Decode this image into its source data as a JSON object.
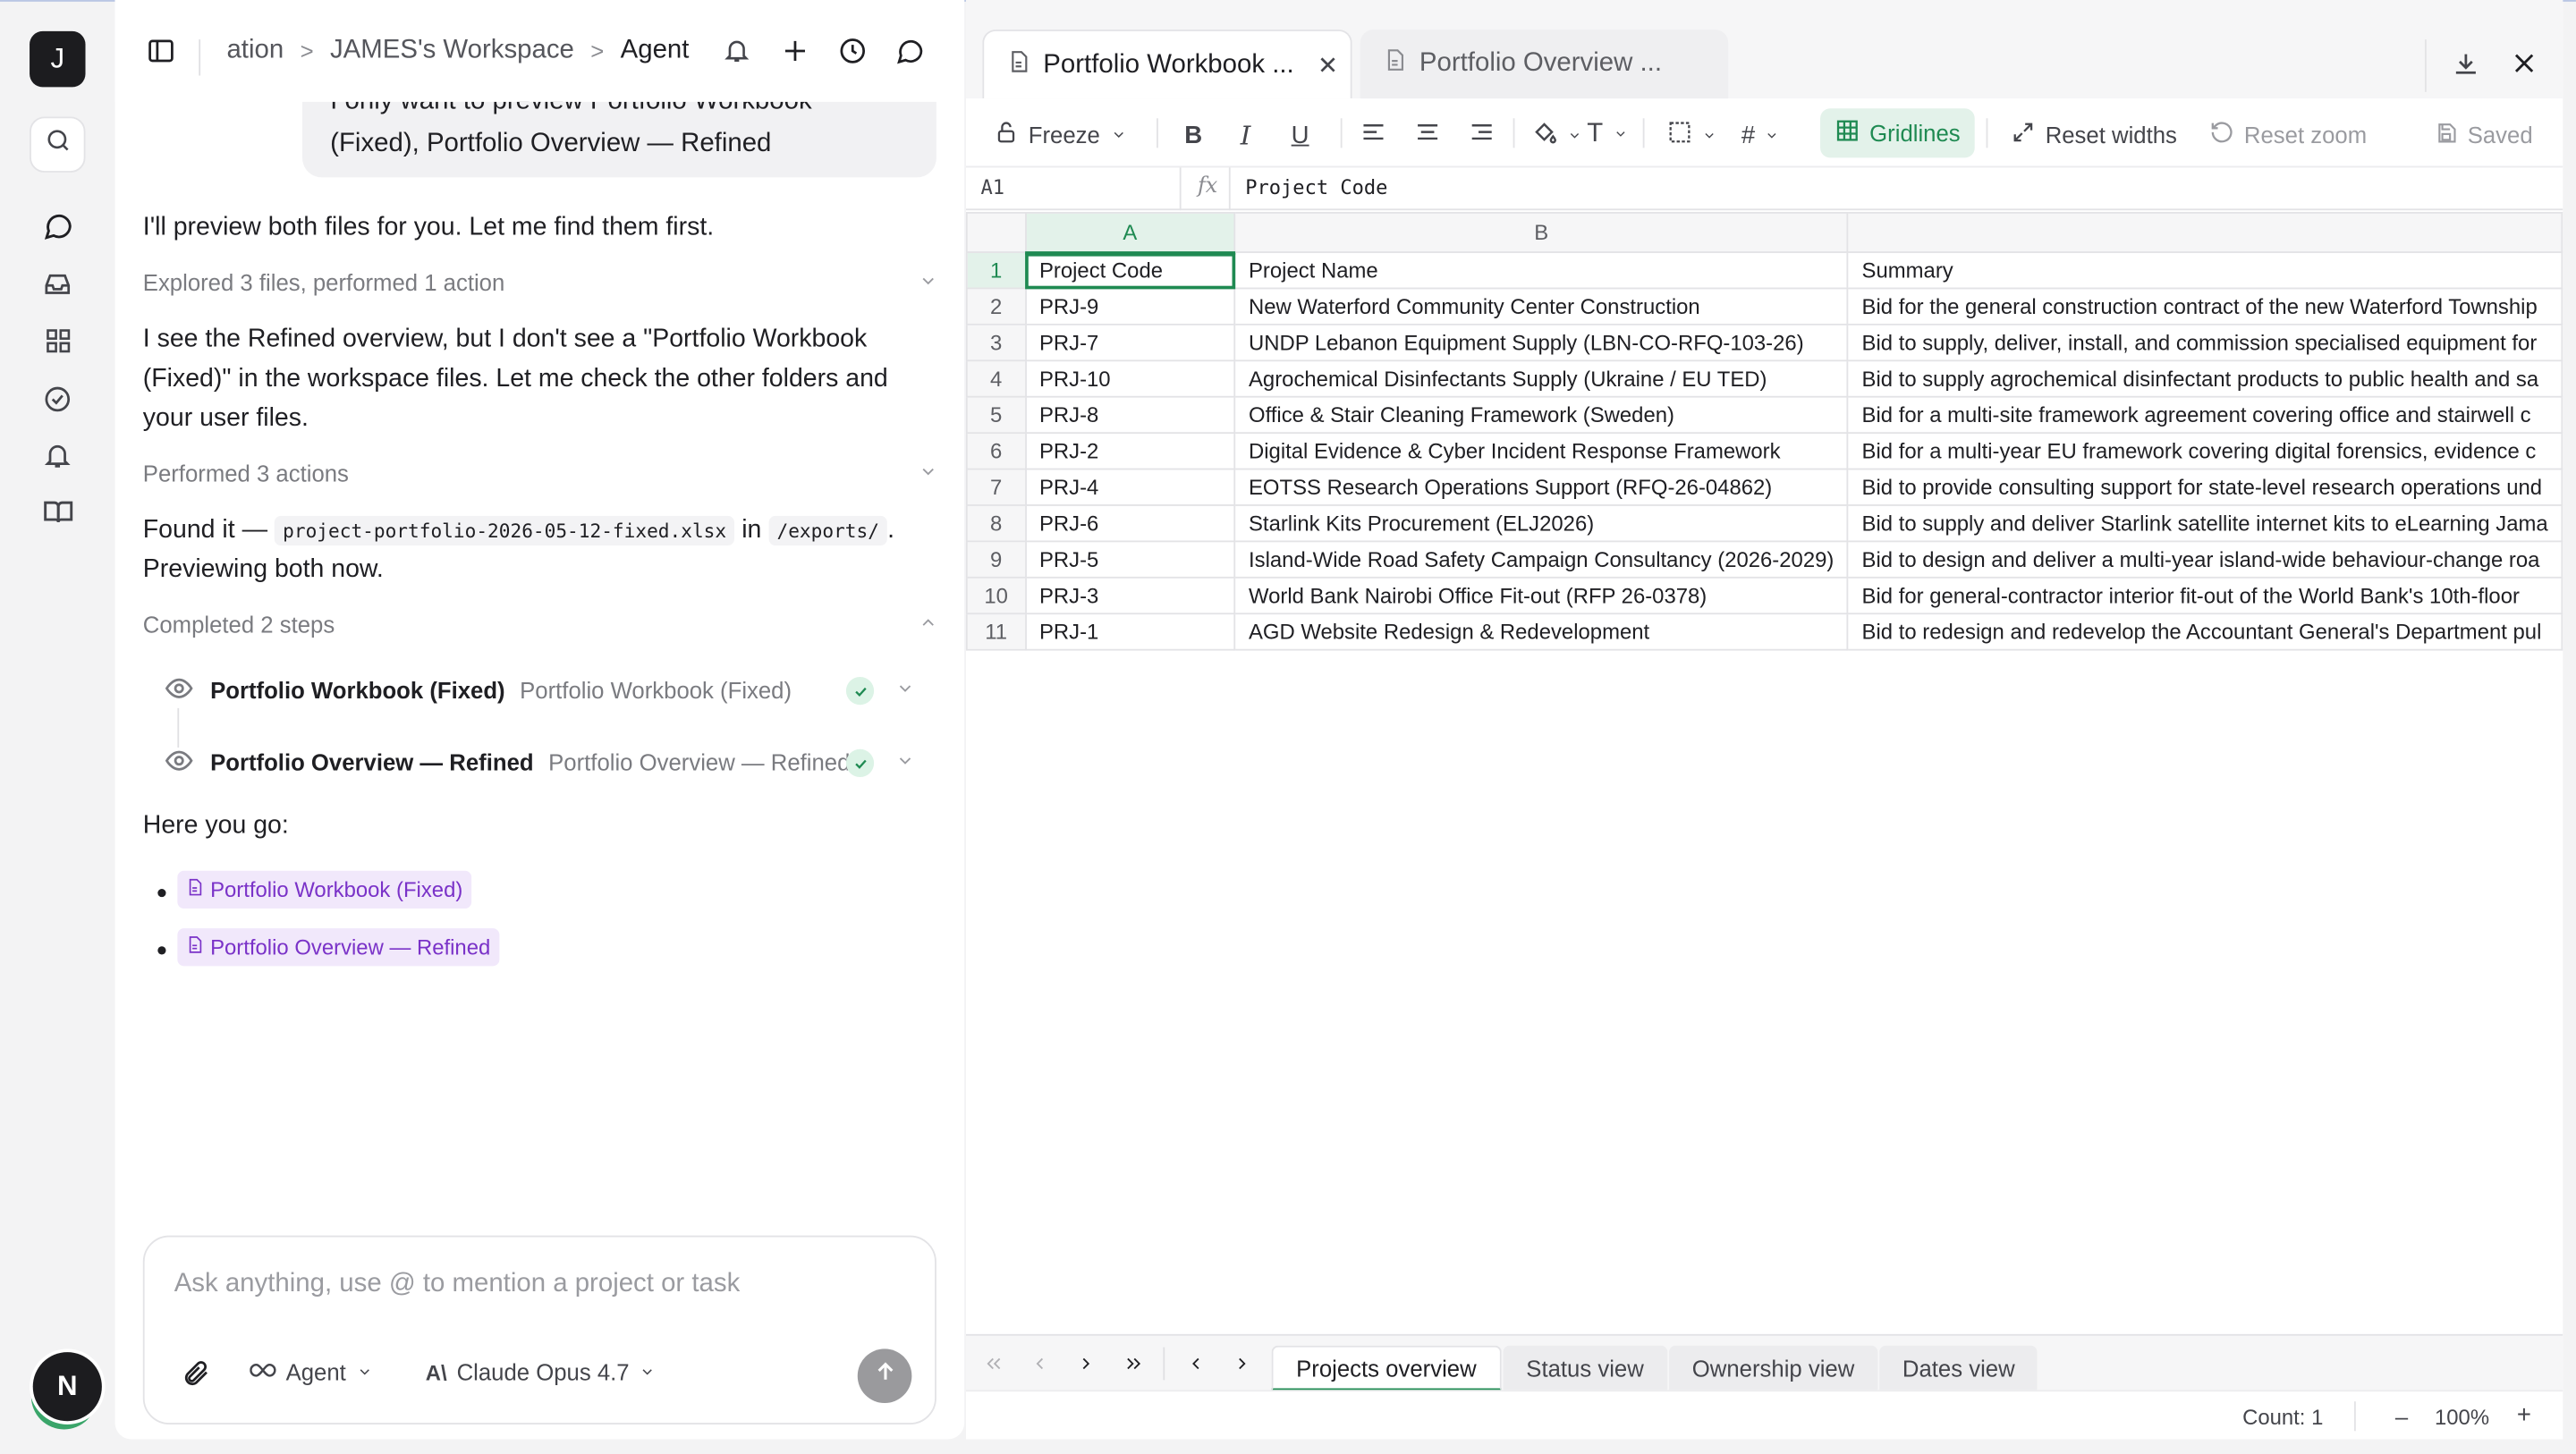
{
  "rail": {
    "workspace_initial": "J",
    "user_initial": "N",
    "icons": [
      "search-icon",
      "chat-icon",
      "inbox-icon",
      "apps-grid-icon",
      "check-circle-icon",
      "bell-icon",
      "book-icon"
    ]
  },
  "chat": {
    "breadcrumb": {
      "part1": "ation",
      "part2": "JAMES's Workspace",
      "current": "Agent"
    },
    "user_message": {
      "line1_clipped": "I only want to preview Portfolio Workbook",
      "line2": "(Fixed), Portfolio Overview — Refined"
    },
    "msg1": "I'll preview both files for you. Let me find them first.",
    "step1": "Explored 3 files, performed 1 action",
    "msg2": "I see the Refined overview, but I don't see a \"Portfolio Workbook (Fixed)\" in the workspace files. Let me check the other folders and your user files.",
    "step2": "Performed 3 actions",
    "msg3": {
      "pre": "Found it —",
      "file": "project-portfolio-2026-05-12-fixed.xlsx",
      "mid": "in",
      "path": "/exports/",
      "post": ".",
      "line2": "Previewing both now."
    },
    "step3": "Completed 2 steps",
    "tools": [
      {
        "title": "Portfolio Workbook (Fixed)",
        "subtitle": "Portfolio Workbook (Fixed)"
      },
      {
        "title": "Portfolio Overview — Refined",
        "subtitle": "Portfolio Overview — Refined"
      }
    ],
    "msg4": "Here you go:",
    "links": [
      "Portfolio Workbook (Fixed)",
      "Portfolio Overview — Refined"
    ],
    "composer": {
      "placeholder": "Ask anything, use @ to mention a project or task",
      "mode": "Agent",
      "model": "Claude Opus 4.7"
    }
  },
  "sheet": {
    "tabs": [
      {
        "label": "Portfolio Workbook ..."
      },
      {
        "label": "Portfolio Overview ..."
      }
    ],
    "toolbar": {
      "freeze": "Freeze",
      "gridlines": "Gridlines",
      "reset_widths": "Reset widths",
      "reset_zoom": "Reset zoom",
      "saved": "Saved"
    },
    "formula": {
      "ref": "A1",
      "fx": "fx",
      "value": "Project Code"
    },
    "columns": [
      "A",
      "B",
      ""
    ],
    "rows": [
      [
        "1",
        "Project Code",
        "Project Name",
        "Summary"
      ],
      [
        "2",
        "PRJ-9",
        "New Waterford Community Center Construction",
        "Bid for the general construction contract of the new Waterford Township"
      ],
      [
        "3",
        "PRJ-7",
        "UNDP Lebanon Equipment Supply (LBN-CO-RFQ-103-26)",
        "Bid to supply, deliver, install, and commission specialised equipment for"
      ],
      [
        "4",
        "PRJ-10",
        "Agrochemical Disinfectants Supply (Ukraine / EU TED)",
        "Bid to supply agrochemical disinfectant products to public health and sa"
      ],
      [
        "5",
        "PRJ-8",
        "Office & Stair Cleaning Framework (Sweden)",
        "Bid for a multi-site framework agreement covering office and stairwell c"
      ],
      [
        "6",
        "PRJ-2",
        "Digital Evidence & Cyber Incident Response Framework",
        "Bid for a multi-year EU framework covering digital forensics, evidence c"
      ],
      [
        "7",
        "PRJ-4",
        "EOTSS Research Operations Support (RFQ-26-04862)",
        "Bid to provide consulting support for state-level research operations und"
      ],
      [
        "8",
        "PRJ-6",
        "Starlink Kits Procurement (ELJ2026)",
        "Bid to supply and deliver Starlink satellite internet kits to eLearning Jama"
      ],
      [
        "9",
        "PRJ-5",
        "Island-Wide Road Safety Campaign Consultancy (2026-2029)",
        "Bid to design and deliver a multi-year island-wide behaviour-change roa"
      ],
      [
        "10",
        "PRJ-3",
        "World Bank Nairobi Office Fit-out (RFP 26-0378)",
        "Bid for general-contractor interior fit-out of the World Bank's 10th-floor"
      ],
      [
        "11",
        "PRJ-1",
        "AGD Website Redesign & Redevelopment",
        "Bid to redesign and redevelop the Accountant General's Department pul"
      ]
    ],
    "sheet_tabs": [
      "Projects overview",
      "Status view",
      "Ownership view",
      "Dates view"
    ],
    "status": {
      "count": "Count: 1",
      "zoom": "100%",
      "minus": "–",
      "plus": "+"
    },
    "colors": {
      "accent": "#1f8a52",
      "link": "#7a32c8"
    }
  }
}
